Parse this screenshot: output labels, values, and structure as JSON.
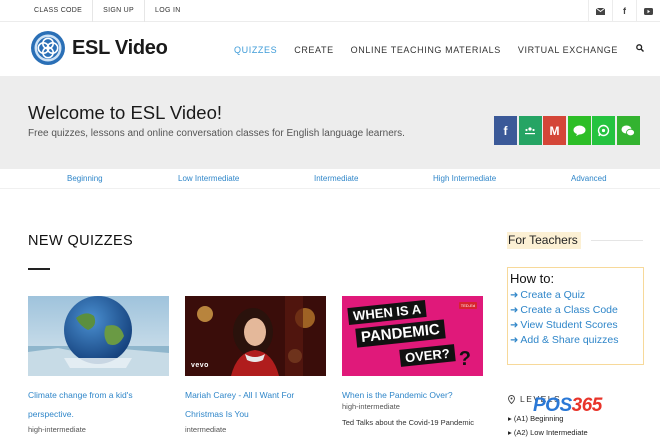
{
  "topbar": {
    "links": [
      "CLASS CODE",
      "SIGN UP",
      "LOG IN"
    ],
    "icons": [
      "mail-icon",
      "facebook-icon",
      "youtube-icon"
    ]
  },
  "header": {
    "logo_text": "ESL Video",
    "nav": [
      "QUIZZES",
      "CREATE",
      "ONLINE TEACHING MATERIALS",
      "VIRTUAL EXCHANGE"
    ],
    "active_nav": "QUIZZES",
    "search_icon": "search-icon"
  },
  "hero": {
    "title": "Welcome to ESL Video!",
    "subtitle": "Free quizzes, lessons and online conversation classes for English language learners.",
    "share_buttons": [
      {
        "name": "facebook-share-button",
        "icon": "f",
        "color": "#3b5998"
      },
      {
        "name": "classroom-share-button",
        "icon": "☰",
        "color": "#25a464"
      },
      {
        "name": "gmail-share-button",
        "icon": "M",
        "color": "#d44638"
      },
      {
        "name": "line-share-button",
        "icon": "▬",
        "color": "#2dbe27"
      },
      {
        "name": "whatsapp-share-button",
        "icon": "✆",
        "color": "#25c33f"
      },
      {
        "name": "wechat-share-button",
        "icon": "●",
        "color": "#33b330"
      }
    ]
  },
  "levels": [
    "Beginning",
    "Low Intermediate",
    "Intermediate",
    "High Intermediate",
    "Advanced"
  ],
  "new_quizzes": {
    "heading": "NEW QUIZZES",
    "cards": [
      {
        "title_line1": "Climate change from a kid's",
        "title_line2": "perspective.",
        "level": "high-intermediate",
        "desc": ""
      },
      {
        "title_line1": "Mariah Carey - All I Want For",
        "title_line2": "Christmas Is You",
        "level": "intermediate",
        "desc": "",
        "thumb_text": "vevo"
      },
      {
        "title_line1": "When is the Pandemic Over?",
        "title_line2": "",
        "level": "high-intermediate",
        "desc": "Ted Talks about the Covid-19 Pandemic",
        "thumb_text_1": "WHEN IS A",
        "thumb_text_2": "PANDEMIC",
        "thumb_text_3": "OVER?",
        "thumb_badge": "TED-Ed"
      }
    ]
  },
  "sidebar": {
    "for_teachers": "For Teachers",
    "howto_title": "How to:",
    "howto_links": [
      "Create a Quiz",
      "Create a Class Code",
      "View Student Scores",
      "Add & Share quizzes"
    ],
    "levels_heading": "LEVELS",
    "levels": [
      "(A1) Beginning",
      "(A2) Low Intermediate"
    ]
  },
  "watermark": {
    "text_blue": "POS",
    "text_red": "365"
  }
}
